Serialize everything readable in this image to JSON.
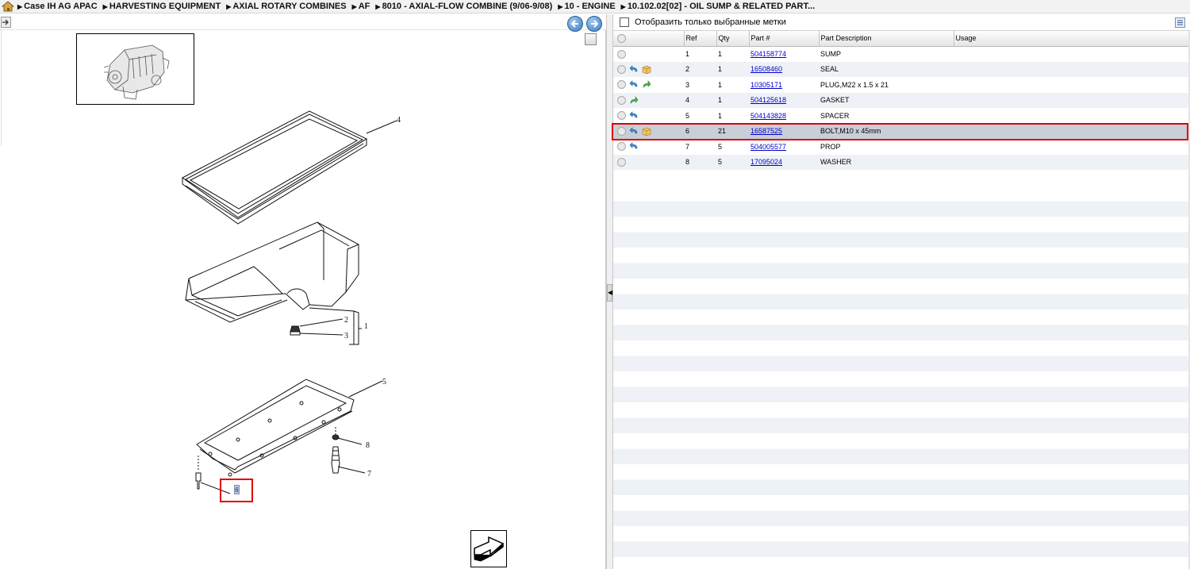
{
  "breadcrumb": [
    "Case IH AG APAC",
    "HARVESTING EQUIPMENT",
    "AXIAL ROTARY COMBINES",
    "AF",
    "8010 - AXIAL-FLOW COMBINE (9/06-9/08)",
    "10 - ENGINE",
    "10.102.02[02] - OIL SUMP & RELATED PART..."
  ],
  "filter": {
    "label": "Отобразить только выбранные метки"
  },
  "table": {
    "headers": {
      "ref": "Ref",
      "qty": "Qty",
      "part": "Part #",
      "desc": "Part Description",
      "usage": "Usage"
    },
    "rows": [
      {
        "ref": "1",
        "qty": "1",
        "part": "504158774",
        "desc": "SUMP",
        "icons": []
      },
      {
        "ref": "2",
        "qty": "1",
        "part": "16508460",
        "desc": "SEAL",
        "icons": [
          "back-arrow-icon",
          "box-icon"
        ]
      },
      {
        "ref": "3",
        "qty": "1",
        "part": "10305171",
        "desc": "PLUG,M22 x 1.5 x 21",
        "icons": [
          "back-arrow-icon",
          "forward-arrow-icon"
        ]
      },
      {
        "ref": "4",
        "qty": "1",
        "part": "504125618",
        "desc": "GASKET",
        "icons": [
          "forward-arrow-icon"
        ]
      },
      {
        "ref": "5",
        "qty": "1",
        "part": "504143828",
        "desc": "SPACER",
        "icons": [
          "back-arrow-icon"
        ]
      },
      {
        "ref": "6",
        "qty": "21",
        "part": "16587525",
        "desc": "BOLT,M10 x 45mm",
        "icons": [
          "back-arrow-icon",
          "box-icon"
        ],
        "selected": true
      },
      {
        "ref": "7",
        "qty": "5",
        "part": "504005577",
        "desc": "PROP",
        "icons": [
          "back-arrow-icon"
        ]
      },
      {
        "ref": "8",
        "qty": "5",
        "part": "17095024",
        "desc": "WASHER",
        "icons": []
      }
    ]
  },
  "diagram": {
    "callouts": [
      "4",
      "2",
      "1",
      "3",
      "5",
      "8",
      "7",
      "6"
    ]
  },
  "colors": {
    "highlight": "#e00000",
    "link": "#0000cc",
    "row_alt": "#eef2f7",
    "row_selected": "#c9cfd8"
  }
}
